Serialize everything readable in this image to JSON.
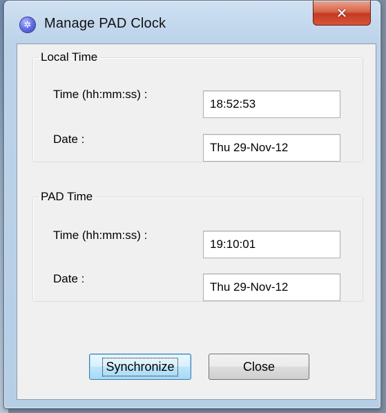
{
  "window": {
    "title": "Manage PAD Clock",
    "close_glyph": "✕",
    "icon": "gear-icon"
  },
  "local_time": {
    "legend": "Local Time",
    "time_label": "Time (hh:mm:ss) :",
    "time_value": "18:52:53",
    "date_label": "Date :",
    "date_value": "Thu 29-Nov-12"
  },
  "pad_time": {
    "legend": "PAD Time",
    "time_label": "Time (hh:mm:ss) :",
    "time_value": "19:10:01",
    "date_label": "Date :",
    "date_value": "Thu 29-Nov-12"
  },
  "buttons": {
    "synchronize": "Synchronize",
    "close": "Close"
  },
  "colors": {
    "close_button": "#c43a21",
    "focused_button": "#3c7fb1",
    "client_background": "#f0f0f0"
  }
}
